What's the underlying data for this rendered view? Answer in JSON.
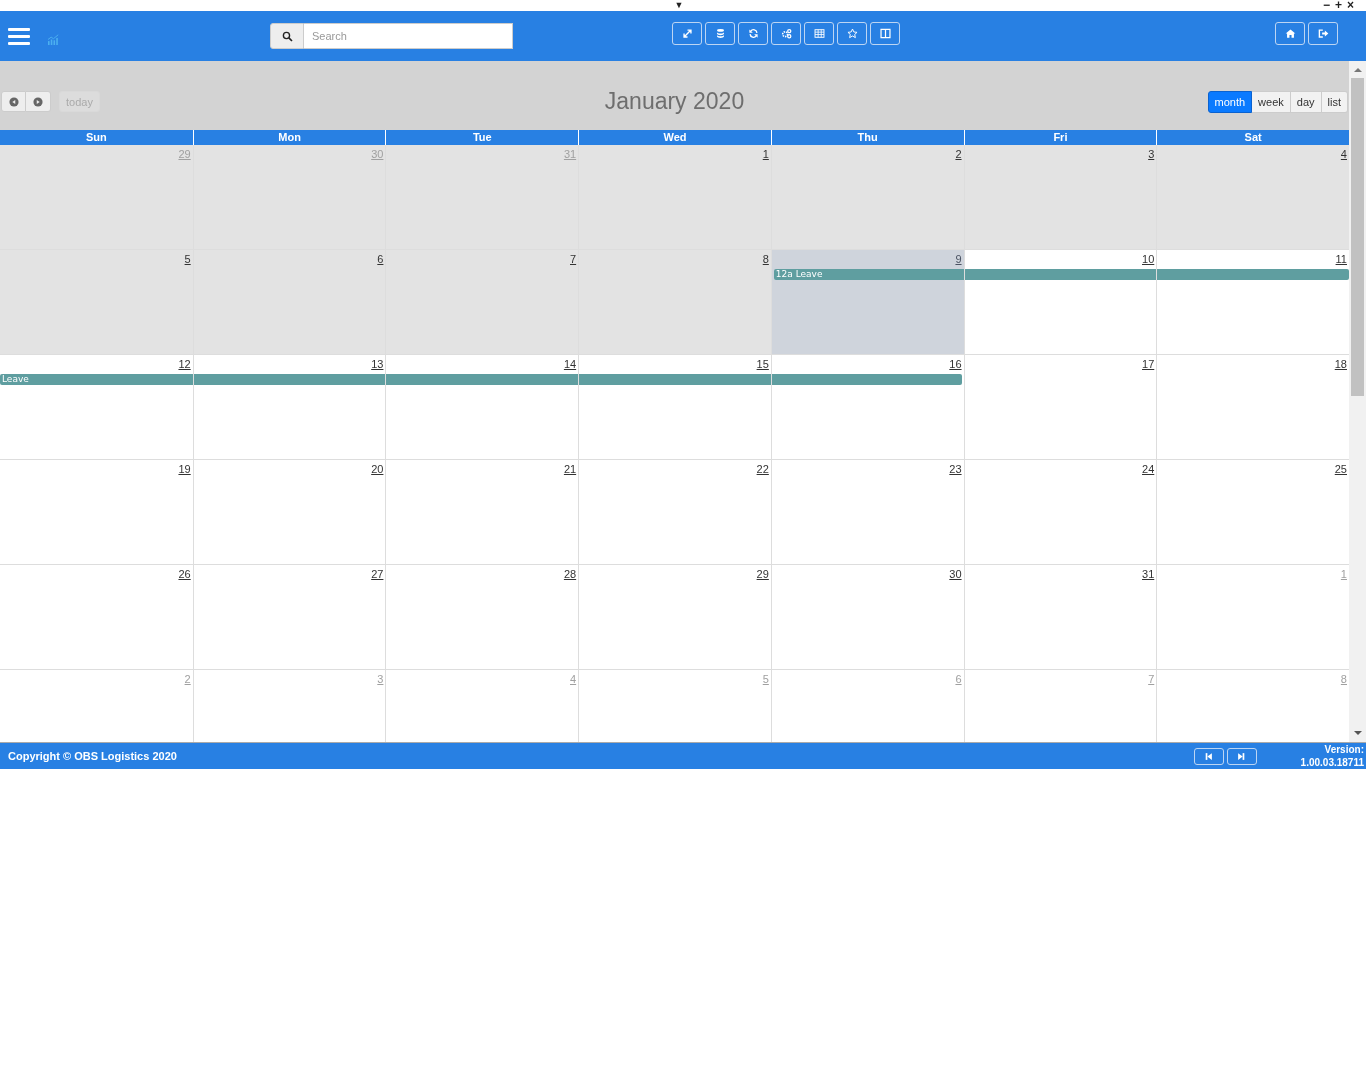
{
  "window_controls": {
    "dropdown": "▼",
    "minimize": "−",
    "maximize": "+",
    "close": "×"
  },
  "header": {
    "search": {
      "placeholder": "Search"
    }
  },
  "calendar": {
    "title": "January 2020",
    "today_label": "today",
    "today_disabled": true,
    "views": [
      {
        "label": "month",
        "selected": true
      },
      {
        "label": "week",
        "selected": false
      },
      {
        "label": "day",
        "selected": false
      },
      {
        "label": "list",
        "selected": false
      }
    ],
    "columns": [
      "Sun",
      "Mon",
      "Tue",
      "Wed",
      "Thu",
      "Fri",
      "Sat"
    ],
    "weeks": [
      {
        "days": [
          {
            "date": "29",
            "kind": "past",
            "other_month": true
          },
          {
            "date": "30",
            "kind": "past",
            "other_month": true
          },
          {
            "date": "31",
            "kind": "past",
            "other_month": true
          },
          {
            "date": "1",
            "kind": "past",
            "other_month": false
          },
          {
            "date": "2",
            "kind": "past",
            "other_month": false
          },
          {
            "date": "3",
            "kind": "past",
            "other_month": false
          },
          {
            "date": "4",
            "kind": "past",
            "other_month": false
          }
        ]
      },
      {
        "days": [
          {
            "date": "5",
            "kind": "past",
            "other_month": false,
            "in_event": false
          },
          {
            "date": "6",
            "kind": "past",
            "other_month": false,
            "in_event": false
          },
          {
            "date": "7",
            "kind": "past",
            "other_month": false,
            "in_event": false
          },
          {
            "date": "8",
            "kind": "past",
            "other_month": false,
            "in_event": false
          },
          {
            "date": "9",
            "kind": "today",
            "other_month": false,
            "in_event": true
          },
          {
            "date": "10",
            "kind": "future",
            "other_month": false,
            "in_event": true
          },
          {
            "date": "11",
            "kind": "future",
            "other_month": false,
            "in_event": true
          }
        ],
        "event_label": "12a Leave"
      },
      {
        "days": [
          {
            "date": "12",
            "kind": "future",
            "other_month": false,
            "in_event": true
          },
          {
            "date": "13",
            "kind": "future",
            "other_month": false,
            "in_event": true
          },
          {
            "date": "14",
            "kind": "future",
            "other_month": false,
            "in_event": true
          },
          {
            "date": "15",
            "kind": "future",
            "other_month": false,
            "in_event": true
          },
          {
            "date": "16",
            "kind": "future",
            "other_month": false,
            "in_event": true
          },
          {
            "date": "17",
            "kind": "future",
            "other_month": false,
            "in_event": false
          },
          {
            "date": "18",
            "kind": "future",
            "other_month": false,
            "in_event": false
          }
        ],
        "event_label": "Leave"
      },
      {
        "days": [
          {
            "date": "19",
            "kind": "future",
            "other_month": false
          },
          {
            "date": "20",
            "kind": "future",
            "other_month": false
          },
          {
            "date": "21",
            "kind": "future",
            "other_month": false
          },
          {
            "date": "22",
            "kind": "future",
            "other_month": false
          },
          {
            "date": "23",
            "kind": "future",
            "other_month": false
          },
          {
            "date": "24",
            "kind": "future",
            "other_month": false
          },
          {
            "date": "25",
            "kind": "future",
            "other_month": false
          }
        ]
      },
      {
        "days": [
          {
            "date": "26",
            "kind": "future",
            "other_month": false
          },
          {
            "date": "27",
            "kind": "future",
            "other_month": false
          },
          {
            "date": "28",
            "kind": "future",
            "other_month": false
          },
          {
            "date": "29",
            "kind": "future",
            "other_month": false
          },
          {
            "date": "30",
            "kind": "future",
            "other_month": false
          },
          {
            "date": "31",
            "kind": "future",
            "other_month": false
          },
          {
            "date": "1",
            "kind": "future",
            "other_month": true
          }
        ]
      },
      {
        "days": [
          {
            "date": "2",
            "kind": "future",
            "other_month": true
          },
          {
            "date": "3",
            "kind": "future",
            "other_month": true
          },
          {
            "date": "4",
            "kind": "future",
            "other_month": true
          },
          {
            "date": "5",
            "kind": "future",
            "other_month": true
          },
          {
            "date": "6",
            "kind": "future",
            "other_month": true
          },
          {
            "date": "7",
            "kind": "future",
            "other_month": true
          },
          {
            "date": "8",
            "kind": "future",
            "other_month": true
          }
        ]
      }
    ]
  },
  "footer": {
    "copyright": "Copyright © OBS Logistics 2020",
    "version_label": "Version:",
    "version": "1.00.03.18711"
  }
}
